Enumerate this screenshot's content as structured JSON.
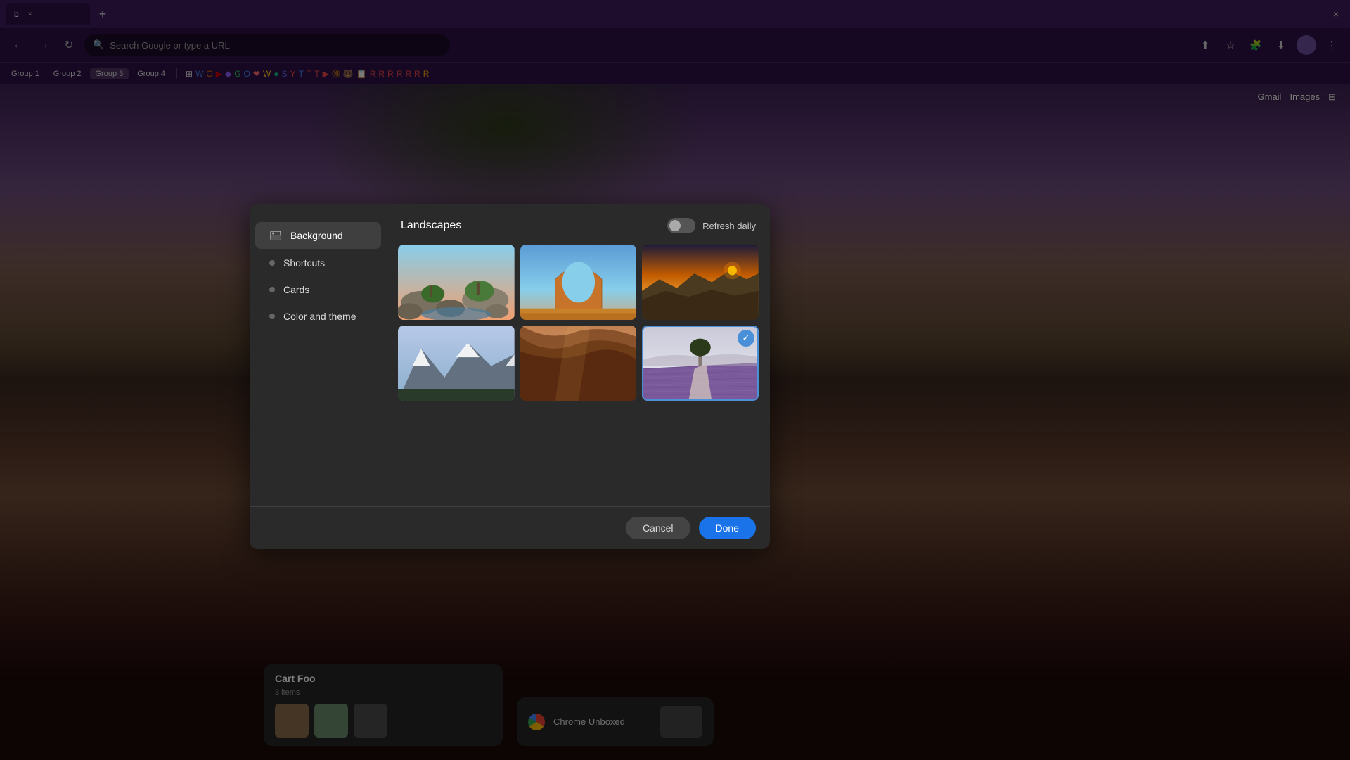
{
  "browser": {
    "tab_title": "b",
    "tab_close_label": "×",
    "new_tab_label": "+",
    "window_minimize": "—",
    "window_close": "×",
    "url_placeholder": "Search Google or type a URL",
    "bookmark_groups": [
      "Group 1",
      "Group 2",
      "Group 3",
      "Group 4"
    ],
    "top_right_links": [
      "Gmail",
      "Images"
    ]
  },
  "dialog": {
    "title": "Landscapes",
    "refresh_label": "Refresh daily",
    "sidebar_items": [
      {
        "id": "background",
        "label": "Background",
        "active": true,
        "icon": "image"
      },
      {
        "id": "shortcuts",
        "label": "Shortcuts",
        "active": false,
        "icon": "dot"
      },
      {
        "id": "cards",
        "label": "Cards",
        "active": false,
        "icon": "dot"
      },
      {
        "id": "color-and-theme",
        "label": "Color and theme",
        "active": false,
        "icon": "dot"
      }
    ],
    "cancel_label": "Cancel",
    "done_label": "Done"
  },
  "bottom": {
    "cart_title": "Cart Foo",
    "cart_subtitle": "3 items",
    "chrome_label": "Chrome Unboxed"
  }
}
